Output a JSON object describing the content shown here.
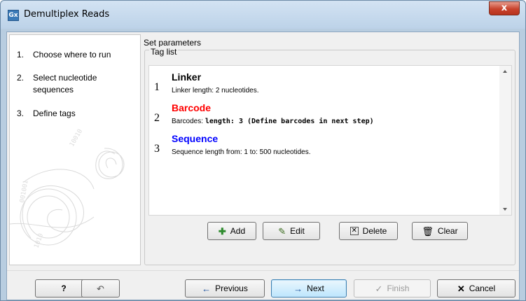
{
  "window": {
    "title": "Demultiplex Reads",
    "app_icon_text": "Gx",
    "close_label": "x"
  },
  "steps": [
    {
      "num": "1.",
      "label": "Choose where to run"
    },
    {
      "num": "2.",
      "label": "Select nucleotide sequences"
    },
    {
      "num": "3.",
      "label": "Define tags"
    }
  ],
  "panel": {
    "heading": "Set parameters",
    "group_label": "Tag list"
  },
  "tags": [
    {
      "num": "1",
      "name": "Linker",
      "color": "#000000",
      "desc_prefix": "Linker length: 2 nucleotides.",
      "desc_bold": ""
    },
    {
      "num": "2",
      "name": "Barcode",
      "color": "#ff0000",
      "desc_prefix": "Barcodes: ",
      "desc_bold": "length: 3 (Define barcodes in next step)"
    },
    {
      "num": "3",
      "name": "Sequence",
      "color": "#0000ff",
      "desc_prefix": "Sequence length from: 1 to: 500 nucleotides.",
      "desc_bold": ""
    }
  ],
  "tag_buttons": {
    "add": "Add",
    "edit": "Edit",
    "delete": "Delete",
    "clear": "Clear"
  },
  "footer": {
    "help": "?",
    "previous": "Previous",
    "next": "Next",
    "finish": "Finish",
    "cancel": "Cancel"
  },
  "icons": {
    "add": "plus-icon",
    "edit": "pencil-icon",
    "delete": "delete-box-icon",
    "clear": "trash-icon",
    "reset": "undo-arrow-icon",
    "previous": "arrow-left-icon",
    "next": "arrow-right-icon",
    "finish": "check-icon",
    "cancel": "x-icon"
  }
}
